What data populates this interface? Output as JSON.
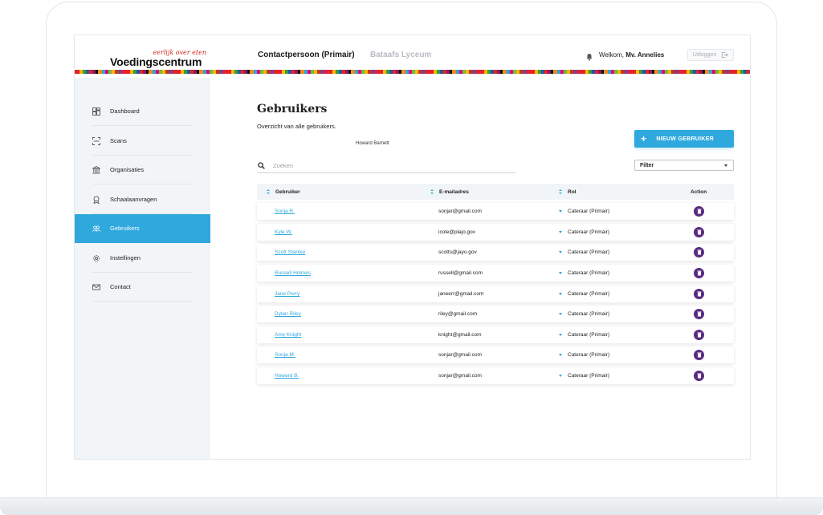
{
  "header": {
    "logo_tagline": "eerlijk over eten",
    "logo_name": "Voedingscentrum",
    "tab_active": "Contactpersoon (Primair)",
    "tab_inactive": "Bataafs Lyceum",
    "welcome_prefix": "Welkom,",
    "welcome_name": "Mv. Annelies",
    "logout_label": "Uitloggen"
  },
  "sidebar": {
    "items": [
      {
        "label": "Dashboard",
        "icon": "dashboard-icon",
        "active": false
      },
      {
        "label": "Scans",
        "icon": "scan-icon",
        "active": false
      },
      {
        "label": "Organisaties",
        "icon": "building-icon",
        "active": false
      },
      {
        "label": "Schaalaanvragen",
        "icon": "award-icon",
        "active": false
      },
      {
        "label": "Gebruikers",
        "icon": "users-icon",
        "active": true
      },
      {
        "label": "Instellingen",
        "icon": "gear-icon",
        "active": false
      },
      {
        "label": "Contact",
        "icon": "mail-icon",
        "active": false
      }
    ]
  },
  "main": {
    "title": "Gebruikers",
    "subtitle": "Overzicht van alle gebruikers.",
    "stray_name": "Howard Barnett",
    "new_user_label": "NIEUW GEBRUIKER",
    "search_placeholder": "Zoeken",
    "filter_label": "Filter"
  },
  "table": {
    "columns": [
      "Gebruiker",
      "E-mailadres",
      "Rol",
      "Action"
    ],
    "rows": [
      {
        "name": "Sonja R.",
        "email": "sonjar@gmail.com",
        "role": "Cateraar (Primair)"
      },
      {
        "name": "Kyle W.",
        "email": "icole@plajo.gov",
        "role": "Cateraar (Primair)"
      },
      {
        "name": "Scott Stanley",
        "email": "scotts@jayo.gov",
        "role": "Cateraar (Primair)"
      },
      {
        "name": "Russell Holmes",
        "email": "russell@gmail.com",
        "role": "Cateraar (Primair)"
      },
      {
        "name": "Jane Perry",
        "email": "janeerr@gmail.com",
        "role": "Cateraar (Primair)"
      },
      {
        "name": "Dylan Riley",
        "email": "riley@gmail.com",
        "role": "Cateraar (Primair)"
      },
      {
        "name": "Amy Knight",
        "email": "knight@gmail.com",
        "role": "Cateraar (Primair)"
      },
      {
        "name": "Sonja M.",
        "email": "sonjar@gmail.com",
        "role": "Cateraar (Primair)"
      },
      {
        "name": "Howard B.",
        "email": "sonjar@gmail.com",
        "role": "Cateraar (Primair)"
      }
    ]
  },
  "colors": {
    "accent": "#2fa9dd",
    "action": "#5a2a82",
    "logo_red": "#d0271e",
    "sidebar_bg": "#f1f5f8"
  }
}
